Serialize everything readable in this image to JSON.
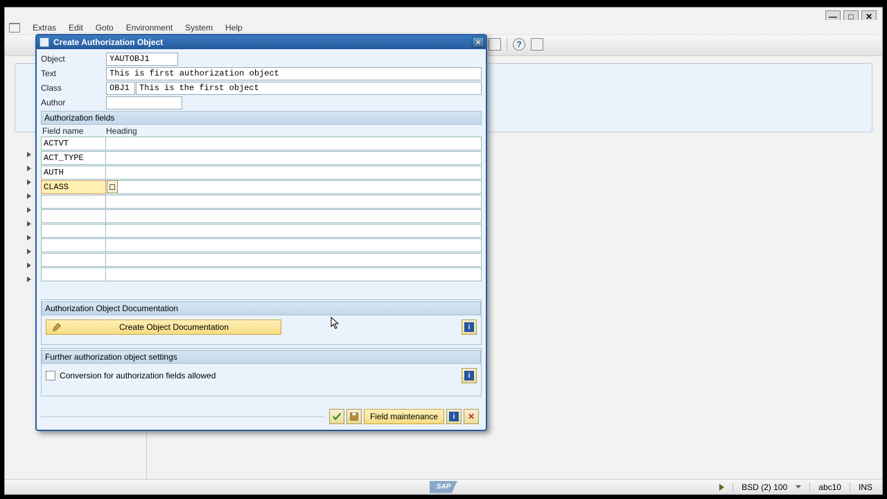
{
  "menu": {
    "items": [
      "Extras",
      "Edit",
      "Goto",
      "Environment",
      "System",
      "Help"
    ]
  },
  "dialog": {
    "title": "Create Authorization Object",
    "labels": {
      "object": "Object",
      "text": "Text",
      "class": "Class",
      "author": "Author"
    },
    "values": {
      "object": "YAUTOBJ1",
      "text": "This is first authorization object",
      "class_code": "OBJ1",
      "class_desc": "This is the first object",
      "author": ""
    },
    "auth_fields_header": "Authorization fields",
    "columns": {
      "name": "Field name",
      "heading": "Heading"
    },
    "rows": [
      {
        "name": "ACTVT",
        "heading": ""
      },
      {
        "name": "ACT_TYPE",
        "heading": ""
      },
      {
        "name": "AUTH",
        "heading": ""
      },
      {
        "name": "CLASS",
        "heading": "",
        "selected": true
      },
      {
        "name": "",
        "heading": ""
      },
      {
        "name": "",
        "heading": ""
      },
      {
        "name": "",
        "heading": ""
      },
      {
        "name": "",
        "heading": ""
      },
      {
        "name": "",
        "heading": ""
      },
      {
        "name": "",
        "heading": ""
      }
    ],
    "doc_header": "Authorization Object Documentation",
    "doc_button": "Create Object Documentation",
    "further_header": "Further authorization object settings",
    "further_checkbox": "Conversion for authorization fields allowed",
    "field_maint_button": "Field maintenance"
  },
  "status": {
    "session": "BSD (2) 100",
    "client": "abc10",
    "mode": "INS"
  },
  "icons": {
    "info": "i",
    "close": "×",
    "cancel": "✕"
  }
}
